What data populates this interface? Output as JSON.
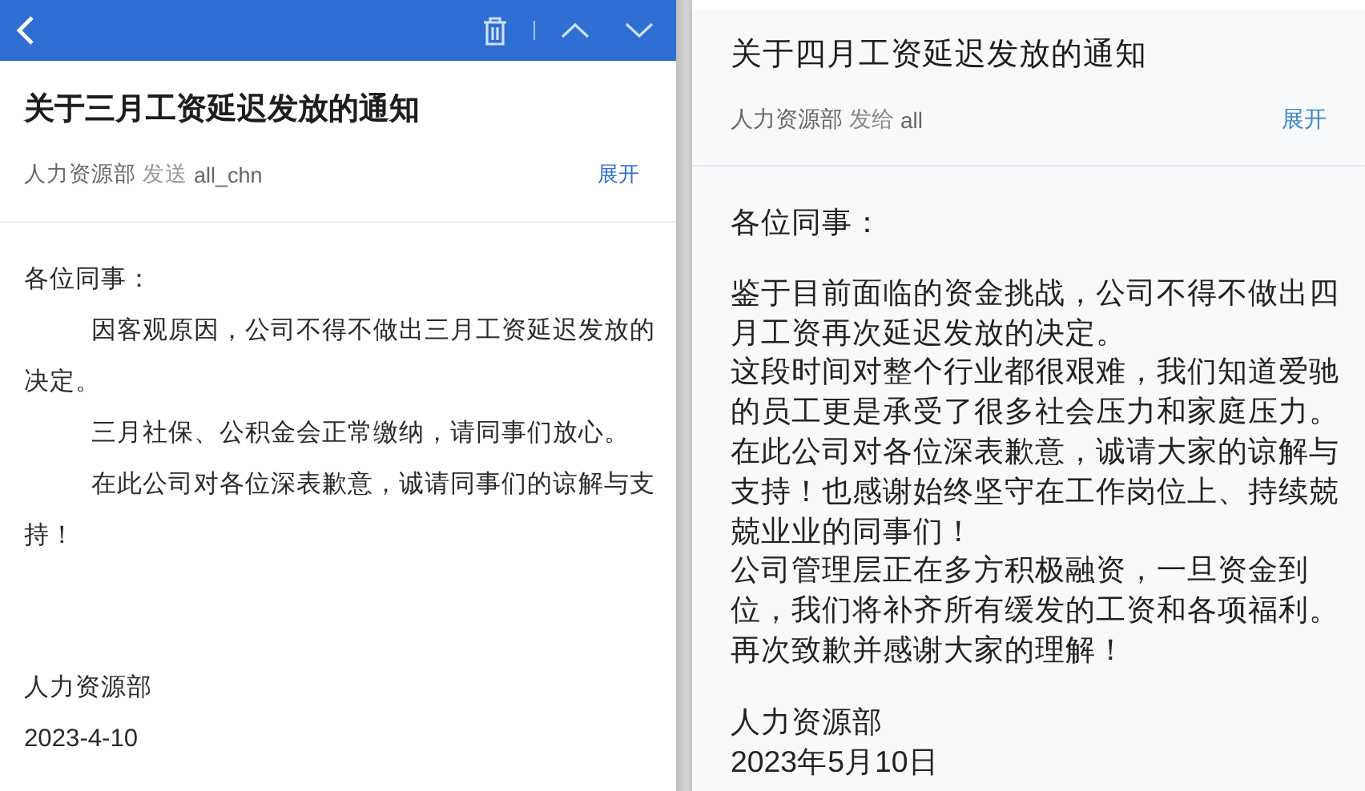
{
  "left_email": {
    "subject": "关于三月工资延迟发放的通知",
    "sender": "人力资源部",
    "action": "发送",
    "recipient": "all_chn",
    "expand": "展开",
    "greeting": "各位同事：",
    "paragraphs": [
      "因客观原因，公司不得不做出三月工资延迟发放的决定。",
      "三月社保、公积金会正常缴纳，请同事们放心。",
      "在此公司对各位深表歉意，诚请同事们的谅解与支持！"
    ],
    "signature": "人力资源部",
    "date": "2023-4-10"
  },
  "right_email": {
    "subject": "关于四月工资延迟发放的通知",
    "sender": "人力资源部",
    "action": "发给",
    "recipient": "all",
    "expand": "展开",
    "greeting": "各位同事：",
    "paragraphs": [
      "鉴于目前面临的资金挑战，公司不得不做出四月工资再次延迟发放的决定。",
      "这段时间对整个行业都很艰难，我们知道爱驰的员工更是承受了很多社会压力和家庭压力。",
      "在此公司对各位深表歉意，诚请大家的谅解与支持！也感谢始终坚守在工作岗位上、持续兢兢业业的同事们！",
      "公司管理层正在多方积极融资，一旦资金到位，我们将补齐所有缓发的工资和各项福利。",
      "再次致歉并感谢大家的理解！"
    ],
    "signature": "人力资源部",
    "date": "2023年5月10日"
  }
}
